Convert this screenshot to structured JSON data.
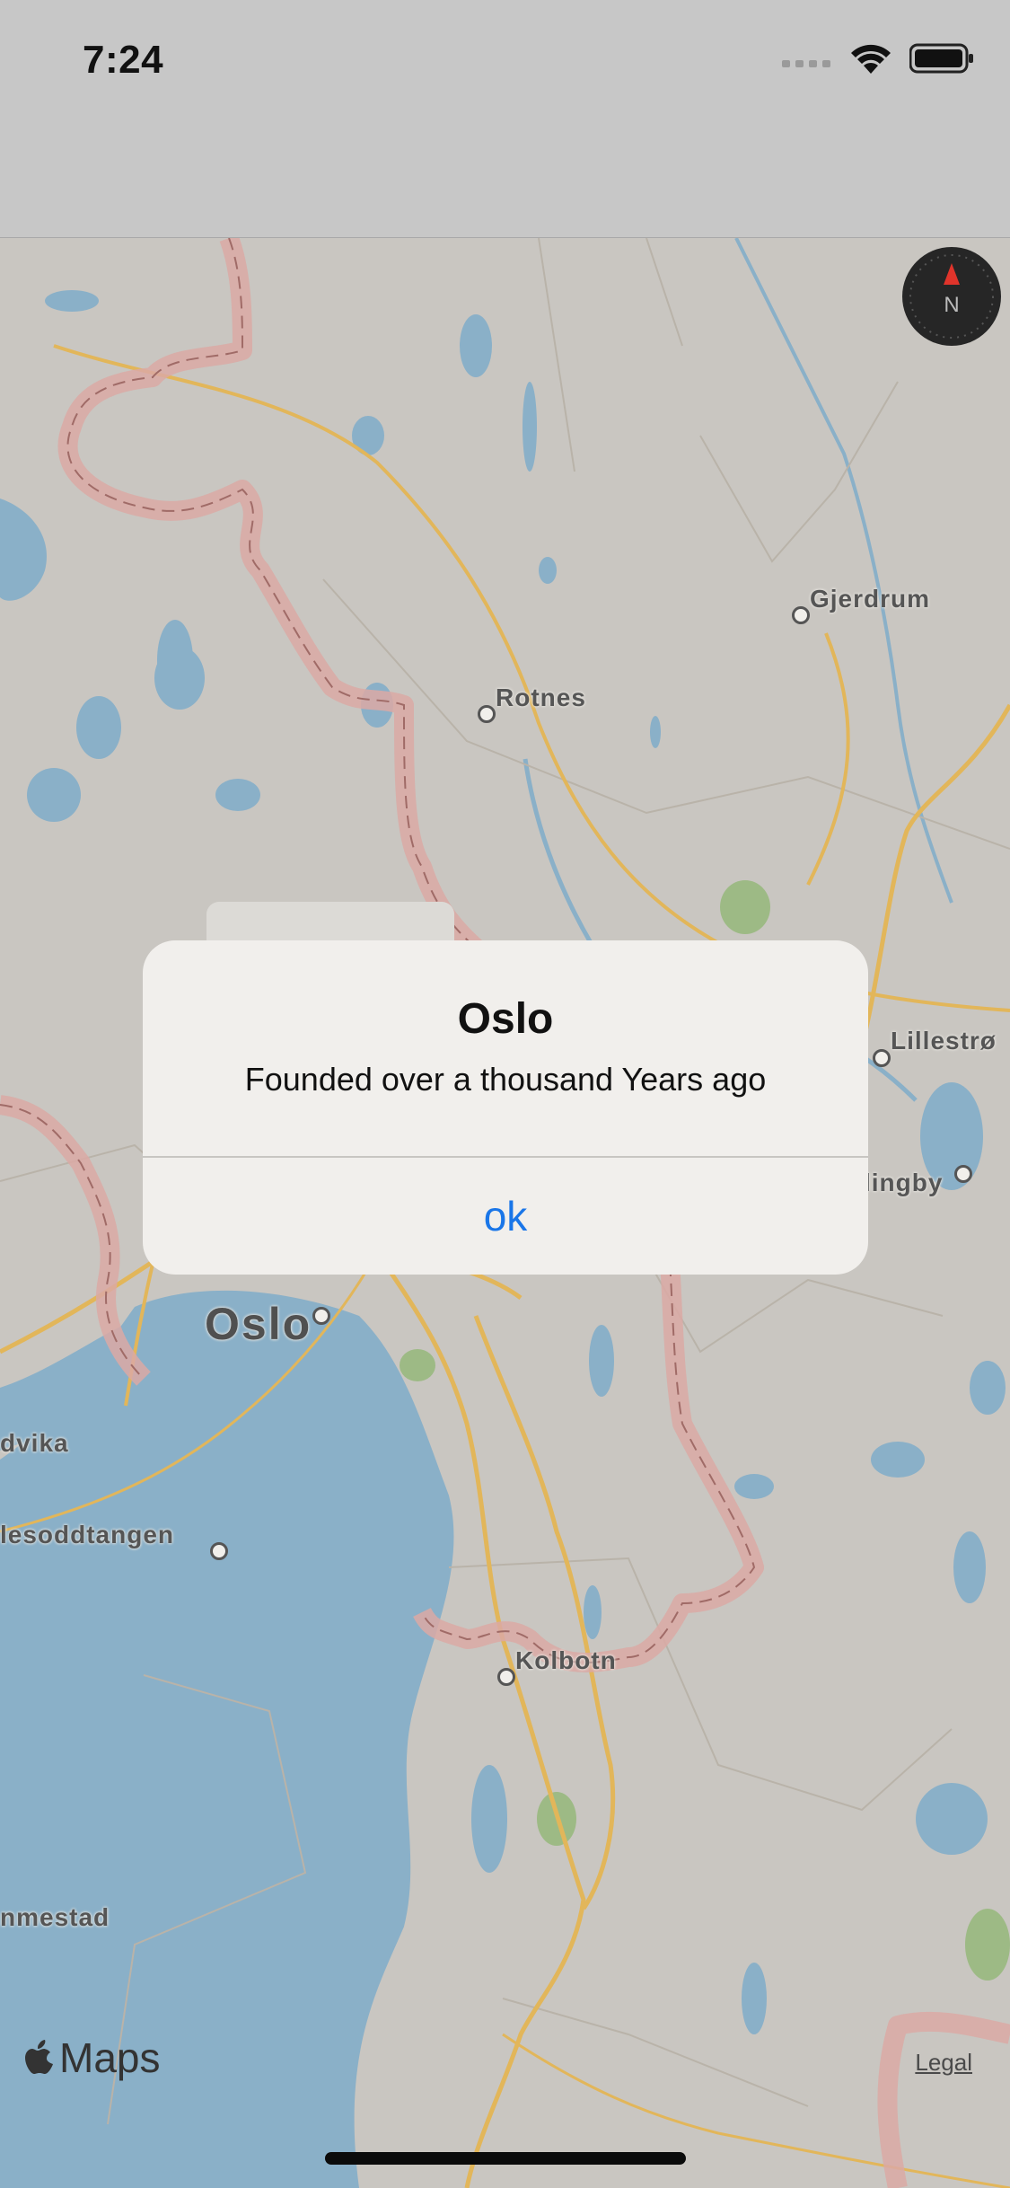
{
  "status_bar": {
    "time": "7:24"
  },
  "map": {
    "places": [
      {
        "label": "Gjerdrum"
      },
      {
        "label": "Rotnes"
      },
      {
        "label": "Lillestrø"
      },
      {
        "label": "lingby"
      },
      {
        "label": "Oslo"
      },
      {
        "label": "dvika"
      },
      {
        "label": "lesoddtangen"
      },
      {
        "label": "Kolbotn"
      },
      {
        "label": "nmestad"
      }
    ],
    "compass_label": "N",
    "attribution": "Maps",
    "legal_link": "Legal",
    "colors": {
      "land": "#c9c6c1",
      "water": "#8ab0c8",
      "road": "#e2b65a",
      "border": "#dba9a4",
      "park": "#9dba85"
    }
  },
  "alert": {
    "title": "Oslo",
    "message": "Founded over a thousand Years ago",
    "button_label": "ok",
    "button_color": "#1a76e8"
  }
}
